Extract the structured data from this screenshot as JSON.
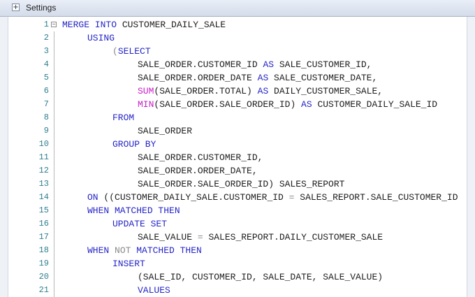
{
  "settings_bar": {
    "label": "Settings",
    "expand_glyph": "+"
  },
  "colors": {
    "keyword": "#2626c8",
    "function": "#c81ec8",
    "operator": "#8a8a8a",
    "identifier": "#1e1e1e",
    "line_number": "#2f7f8f"
  },
  "lines": [
    {
      "n": "1",
      "indent": 0,
      "tokens": [
        {
          "t": "MERGE INTO",
          "c": "kw"
        },
        {
          "t": " CUSTOMER_DAILY_SALE",
          "c": "id"
        }
      ]
    },
    {
      "n": "2",
      "indent": 1,
      "tokens": [
        {
          "t": "USING",
          "c": "kw"
        }
      ]
    },
    {
      "n": "3",
      "indent": 2,
      "tokens": [
        {
          "t": "(",
          "c": "gr"
        },
        {
          "t": "SELECT",
          "c": "kw"
        }
      ]
    },
    {
      "n": "4",
      "indent": 3,
      "tokens": [
        {
          "t": "SALE_ORDER.CUSTOMER_ID ",
          "c": "id"
        },
        {
          "t": "AS",
          "c": "kw"
        },
        {
          "t": " SALE_CUSTOMER_ID,",
          "c": "id"
        }
      ]
    },
    {
      "n": "5",
      "indent": 3,
      "tokens": [
        {
          "t": "SALE_ORDER.ORDER_DATE ",
          "c": "id"
        },
        {
          "t": "AS",
          "c": "kw"
        },
        {
          "t": " SALE_CUSTOMER_DATE,",
          "c": "id"
        }
      ]
    },
    {
      "n": "6",
      "indent": 3,
      "tokens": [
        {
          "t": "SUM",
          "c": "fn"
        },
        {
          "t": "(SALE_ORDER.TOTAL) ",
          "c": "id"
        },
        {
          "t": "AS",
          "c": "kw"
        },
        {
          "t": " DAILY_CUSTOMER_SALE,",
          "c": "id"
        }
      ]
    },
    {
      "n": "7",
      "indent": 3,
      "tokens": [
        {
          "t": "MIN",
          "c": "fn"
        },
        {
          "t": "(SALE_ORDER.SALE_ORDER_ID) ",
          "c": "id"
        },
        {
          "t": "AS",
          "c": "kw"
        },
        {
          "t": " CUSTOMER_DAILY_SALE_ID",
          "c": "id"
        }
      ]
    },
    {
      "n": "8",
      "indent": 2,
      "tokens": [
        {
          "t": "FROM",
          "c": "kw"
        }
      ]
    },
    {
      "n": "9",
      "indent": 3,
      "tokens": [
        {
          "t": "SALE_ORDER",
          "c": "id"
        }
      ]
    },
    {
      "n": "10",
      "indent": 2,
      "tokens": [
        {
          "t": "GROUP BY",
          "c": "kw"
        }
      ]
    },
    {
      "n": "11",
      "indent": 3,
      "tokens": [
        {
          "t": "SALE_ORDER.CUSTOMER_ID,",
          "c": "id"
        }
      ]
    },
    {
      "n": "12",
      "indent": 3,
      "tokens": [
        {
          "t": "SALE_ORDER.ORDER_DATE,",
          "c": "id"
        }
      ]
    },
    {
      "n": "13",
      "indent": 3,
      "tokens": [
        {
          "t": "SALE_ORDER.SALE_ORDER_ID) SALES_REPORT",
          "c": "id"
        }
      ]
    },
    {
      "n": "14",
      "indent": 1,
      "tokens": [
        {
          "t": "ON",
          "c": "kw"
        },
        {
          "t": " ((CUSTOMER_DAILY_SALE.CUSTOMER_ID ",
          "c": "id"
        },
        {
          "t": "=",
          "c": "gr"
        },
        {
          "t": " SALES_REPORT.SALE_CUSTOMER_ID",
          "c": "id"
        }
      ]
    },
    {
      "n": "15",
      "indent": 1,
      "tokens": [
        {
          "t": "WHEN MATCHED THEN",
          "c": "kw"
        }
      ]
    },
    {
      "n": "16",
      "indent": 2,
      "tokens": [
        {
          "t": "UPDATE SET",
          "c": "kw"
        }
      ]
    },
    {
      "n": "17",
      "indent": 3,
      "tokens": [
        {
          "t": "SALE_VALUE ",
          "c": "id"
        },
        {
          "t": "=",
          "c": "gr"
        },
        {
          "t": " SALES_REPORT.DAILY_CUSTOMER_SALE",
          "c": "id"
        }
      ]
    },
    {
      "n": "18",
      "indent": 1,
      "tokens": [
        {
          "t": "WHEN ",
          "c": "kw"
        },
        {
          "t": "NOT",
          "c": "gr"
        },
        {
          "t": " MATCHED THEN",
          "c": "kw"
        }
      ]
    },
    {
      "n": "19",
      "indent": 2,
      "tokens": [
        {
          "t": "INSERT",
          "c": "kw"
        }
      ]
    },
    {
      "n": "20",
      "indent": 3,
      "tokens": [
        {
          "t": "(SALE_ID, CUSTOMER_ID, SALE_DATE, SALE_VALUE)",
          "c": "id"
        }
      ]
    },
    {
      "n": "21",
      "indent": 3,
      "tokens": [
        {
          "t": "VALUES",
          "c": "kw"
        }
      ]
    }
  ]
}
